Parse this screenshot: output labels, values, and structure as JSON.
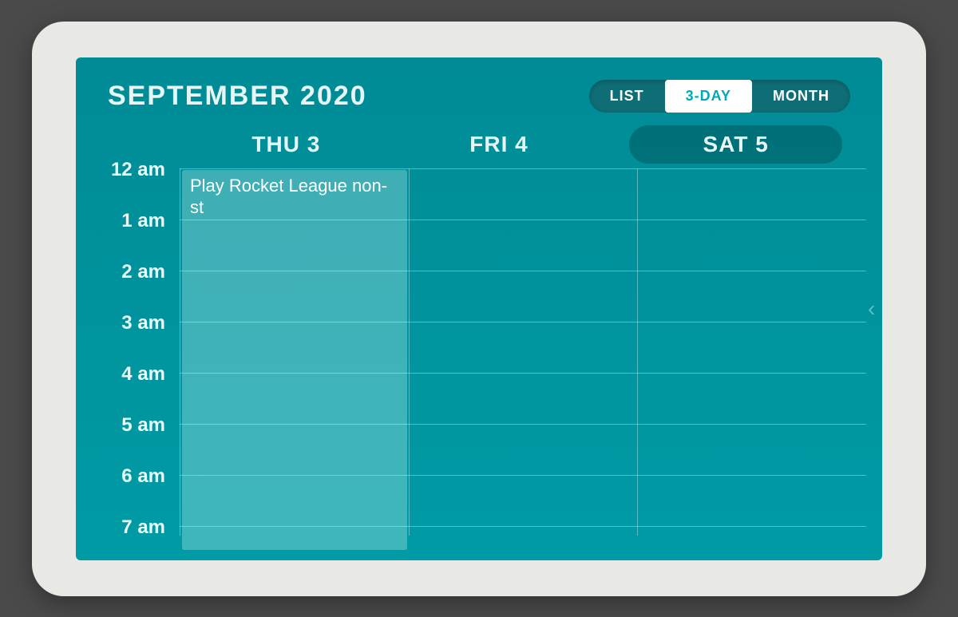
{
  "title": "SEPTEMBER 2020",
  "viewToggle": {
    "list": "LIST",
    "threeDay": "3-DAY",
    "month": "MONTH",
    "active": "3-DAY"
  },
  "days": [
    {
      "label": "THU  3",
      "today": false
    },
    {
      "label": "FRI  4",
      "today": false
    },
    {
      "label": "SAT  5",
      "today": true
    }
  ],
  "hours": [
    "12 am",
    "1 am",
    "2 am",
    "3 am",
    "4 am",
    "5 am",
    "6 am",
    "7 am"
  ],
  "hourPx": 64,
  "events": [
    {
      "dayIndex": 0,
      "startHour": 0,
      "durationHours": 7.5,
      "title": "Play Rocket League non-st"
    }
  ]
}
